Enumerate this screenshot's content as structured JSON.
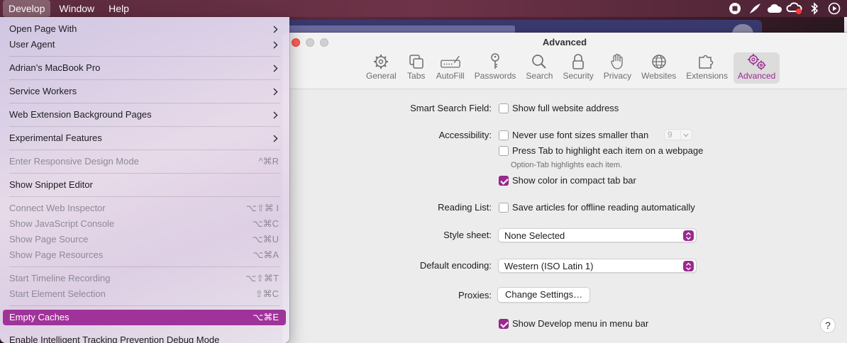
{
  "menubar": {
    "items": [
      {
        "label": "Develop",
        "active": true
      },
      {
        "label": "Window",
        "active": false
      },
      {
        "label": "Help",
        "active": false
      }
    ],
    "status_icons": [
      "stop-record-icon",
      "pen-icon",
      "cloud-icon",
      "creative-cloud-icon",
      "bluetooth-icon",
      "play-circle-icon"
    ]
  },
  "develop_menu": {
    "items": [
      {
        "label": "Open Page With",
        "submenu": true
      },
      {
        "label": "User Agent",
        "submenu": true
      },
      {
        "label": "Adrian’s MacBook Pro",
        "submenu": true
      },
      {
        "label": "Service Workers",
        "submenu": true
      },
      {
        "label": "Web Extension Background Pages",
        "submenu": true
      },
      {
        "label": "Experimental Features",
        "submenu": true
      },
      {
        "label": "Enter Responsive Design Mode",
        "shortcut": "^⌘R",
        "disabled": true
      },
      {
        "label": "Show Snippet Editor"
      },
      {
        "label": "Connect Web Inspector",
        "shortcut": "⌥⇧⌘ I",
        "disabled": true
      },
      {
        "label": "Show JavaScript Console",
        "shortcut": "⌥⌘C",
        "disabled": true
      },
      {
        "label": "Show Page Source",
        "shortcut": "⌥⌘U",
        "disabled": true
      },
      {
        "label": "Show Page Resources",
        "shortcut": "⌥⌘A",
        "disabled": true
      },
      {
        "label": "Start Timeline Recording",
        "shortcut": "⌥⇧⌘T",
        "disabled": true
      },
      {
        "label": "Start Element Selection",
        "shortcut": "⇧⌘C",
        "disabled": true
      },
      {
        "label": "Empty Caches",
        "shortcut": "⌥⌘E",
        "highlighted": true
      },
      {
        "label": "Enable Intelligent Tracking Prevention Debug Mode"
      }
    ]
  },
  "prefs": {
    "title": "Advanced",
    "tabs": [
      {
        "label": "General",
        "icon": "gear-icon"
      },
      {
        "label": "Tabs",
        "icon": "tabs-icon"
      },
      {
        "label": "AutoFill",
        "icon": "autofill-icon"
      },
      {
        "label": "Passwords",
        "icon": "key-icon"
      },
      {
        "label": "Search",
        "icon": "search-icon"
      },
      {
        "label": "Security",
        "icon": "lock-icon"
      },
      {
        "label": "Privacy",
        "icon": "hand-icon"
      },
      {
        "label": "Websites",
        "icon": "globe-icon"
      },
      {
        "label": "Extensions",
        "icon": "puzzle-icon"
      },
      {
        "label": "Advanced",
        "icon": "gears-icon",
        "active": true
      }
    ],
    "smart_search": {
      "label": "Smart Search Field:",
      "option": "Show full website address",
      "checked": false
    },
    "accessibility": {
      "label": "Accessibility:",
      "font_size_option": "Never use font sizes smaller than",
      "font_size_value": "9",
      "font_size_checked": false,
      "tab_option": "Press Tab to highlight each item on a webpage",
      "tab_checked": false,
      "tab_hint": "Option-Tab highlights each item.",
      "color_option": "Show color in compact tab bar",
      "color_checked": true
    },
    "reading_list": {
      "label": "Reading List:",
      "option": "Save articles for offline reading automatically",
      "checked": false
    },
    "style_sheet": {
      "label": "Style sheet:",
      "value": "None Selected"
    },
    "encoding": {
      "label": "Default encoding:",
      "value": "Western (ISO Latin 1)"
    },
    "proxies": {
      "label": "Proxies:",
      "button": "Change Settings…"
    },
    "develop_menu": {
      "option": "Show Develop menu in menu bar",
      "checked": true
    },
    "help": "?"
  },
  "colors": {
    "accent": "#9b2a8f",
    "menu_highlight": "#a0339a",
    "close": "#ff5f57"
  }
}
